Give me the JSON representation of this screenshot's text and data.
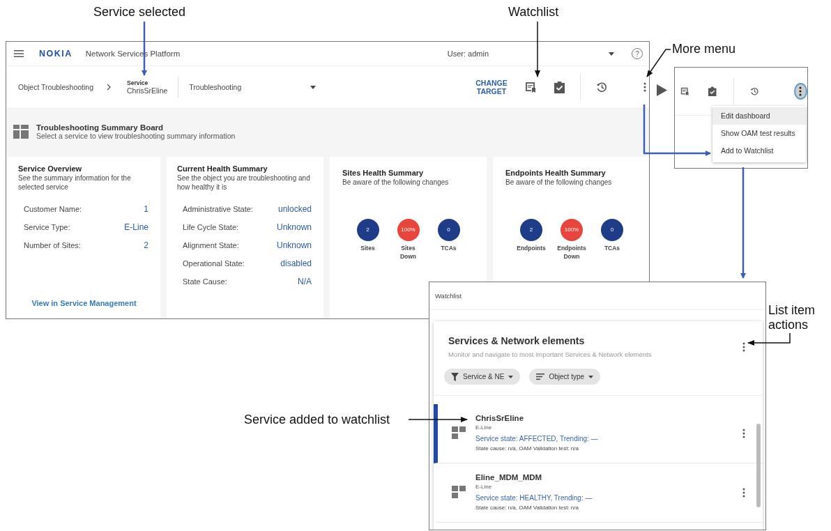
{
  "callouts": [
    {
      "kind": "service_selected",
      "text": "Service selected"
    },
    {
      "kind": "watchlist",
      "text": "Watchlist"
    },
    {
      "kind": "more_menu",
      "text": "More menu"
    },
    {
      "kind": "list_item_actions",
      "text": "List item actions"
    },
    {
      "kind": "service_added",
      "text": "Service added to watchlist"
    }
  ],
  "main_window": {
    "header": {
      "logo": "NOKIA",
      "app_name": "Network Services Platform",
      "user": "User: admin",
      "help": "?"
    },
    "toolbar": {
      "breadcrumb_root": "Object Troubleshooting",
      "service_label": "Service",
      "service_name": "ChrisSrEline",
      "view": "Troubleshooting",
      "change_target": "CHANGE TARGET"
    },
    "board": {
      "title": "Troubleshooting Summary Board",
      "subtitle": "Select a service to view troubleshooting summary information"
    },
    "cards": [
      {
        "kind": "fields",
        "title": "Service Overview",
        "subtitle": "See the summary information for the selected service",
        "fields": [
          {
            "label": "Customer Name:",
            "value": "1"
          },
          {
            "label": "Service Type:",
            "value": "E-Line"
          },
          {
            "label": "Number of Sites:",
            "value": "2"
          }
        ],
        "link": "View in Service Management"
      },
      {
        "kind": "fields",
        "title": "Current Health Summary",
        "subtitle": "See the object you are troubleshooting and how healthy it is",
        "fields": [
          {
            "label": "Administrative State:",
            "value": "unlocked"
          },
          {
            "label": "Life Cycle State:",
            "value": "Unknown"
          },
          {
            "label": "Alignment State:",
            "value": "Unknown"
          },
          {
            "label": "Operational State:",
            "value": "disabled"
          },
          {
            "label": "State Cause:",
            "value": "N/A"
          }
        ]
      },
      {
        "kind": "counts",
        "title": "Sites Health Summary",
        "subtitle": "Be aware of the following changes",
        "counts": [
          {
            "value": "2",
            "label": "Sites",
            "color": "#1f3c88"
          },
          {
            "value": "100%",
            "label": "Sites Down",
            "color": "#e8453c"
          },
          {
            "value": "0",
            "label": "TCAs",
            "color": "#1f3c88"
          }
        ]
      },
      {
        "kind": "counts",
        "title": "Endpoints Health Summary",
        "subtitle": "Be aware of the following changes",
        "counts": [
          {
            "value": "2",
            "label": "Endpoints",
            "color": "#1f3c88"
          },
          {
            "value": "100%",
            "label": "Endpoints Down",
            "color": "#e8453c"
          },
          {
            "value": "0",
            "label": "TCAs",
            "color": "#1f3c88"
          }
        ]
      }
    ]
  },
  "more_menu": {
    "items": [
      {
        "label": "Edit dashboard",
        "highlighted": true
      },
      {
        "label": "Show OAM test results",
        "highlighted": false
      },
      {
        "label": "Add to Watchlist",
        "highlighted": false
      }
    ]
  },
  "watchlist": {
    "title": "Watchlist",
    "card_title": "Services & Network elements",
    "card_subtitle": "Monitor and navigate to most important Services & Network elements",
    "filters": [
      {
        "kind": "filter",
        "label": "Service & NE"
      },
      {
        "kind": "sort",
        "label": "Object type"
      }
    ],
    "items": [
      {
        "name": "ChrisSrEline",
        "type": "E-Line",
        "state": "Service state: AFFECTED, Trending: —",
        "details": "State cause: n/a, OAM Validation test: n/a",
        "selected": true
      },
      {
        "name": "Eline_MDM_MDM",
        "type": "E-Line",
        "state": "Service state: HEALTHY, Trending: —",
        "details": "State cause: n/a, OAM Validation test: n/a",
        "selected": false
      }
    ]
  }
}
